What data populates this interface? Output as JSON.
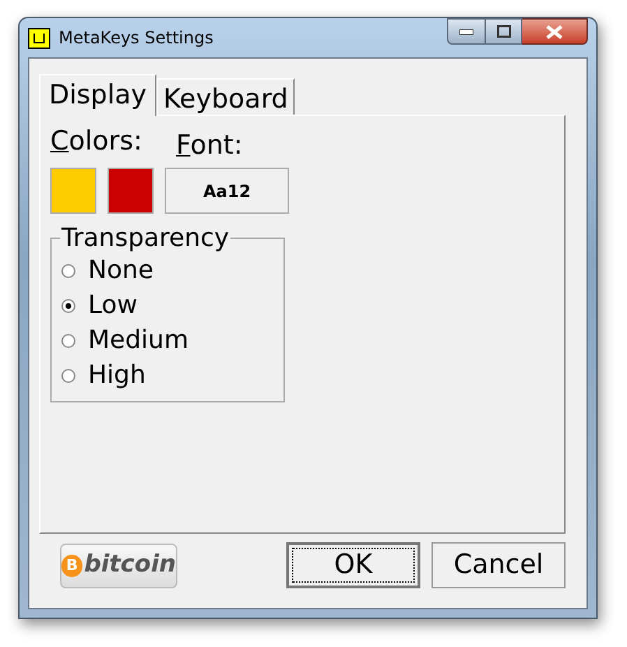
{
  "window": {
    "title": "MetaKeys Settings"
  },
  "tabs": [
    {
      "label": "Display",
      "selected": true
    },
    {
      "label": "Keyboard",
      "selected": false
    }
  ],
  "colors": {
    "label": "Colors:",
    "swatches": [
      {
        "color": "#ffcc00"
      },
      {
        "color": "#cc0000"
      }
    ]
  },
  "font": {
    "label": "Font:",
    "sample": "Aa12"
  },
  "transparency": {
    "title": "Transparency",
    "options": [
      {
        "label": "None",
        "selected": false
      },
      {
        "label": "Low",
        "selected": true
      },
      {
        "label": "Medium",
        "selected": false
      },
      {
        "label": "High",
        "selected": false
      }
    ]
  },
  "donate": {
    "glyph": "B",
    "label": "bitcoin"
  },
  "buttons": [
    {
      "label": "OK",
      "focused": true
    },
    {
      "label": "Cancel",
      "focused": false
    }
  ]
}
